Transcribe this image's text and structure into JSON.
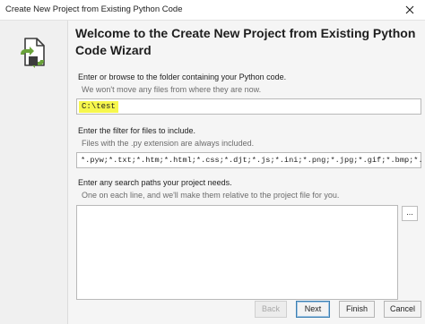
{
  "window": {
    "title": "Create New Project from Existing Python Code"
  },
  "main": {
    "heading": "Welcome to the Create New Project from Existing Python Code Wizard",
    "folder": {
      "label": "Enter or browse to the folder containing your Python code.",
      "hint": "We won't move any files from where they are now.",
      "value": "C:\\test",
      "browse_label": "..."
    },
    "filter": {
      "label": "Enter the filter for files to include.",
      "hint": "Files with the .py extension are always included.",
      "value": "*.pyw;*.txt;*.htm;*.html;*.css;*.djt;*.js;*.ini;*.png;*.jpg;*.gif;*.bmp;*.ico;*.sv"
    },
    "search_paths": {
      "label": "Enter any search paths your project needs.",
      "hint": "One on each line, and we'll make them relative to the project file for you.",
      "value": "",
      "browse_label": "..."
    }
  },
  "footer": {
    "back_label": "Back",
    "next_label": "Next",
    "finish_label": "Finish",
    "cancel_label": "Cancel"
  },
  "colors": {
    "highlight": "#f6f74d",
    "accent_icon": "#6aa33a"
  },
  "icons": {
    "close": "close-icon",
    "wizard": "python-project-wizard-icon"
  }
}
